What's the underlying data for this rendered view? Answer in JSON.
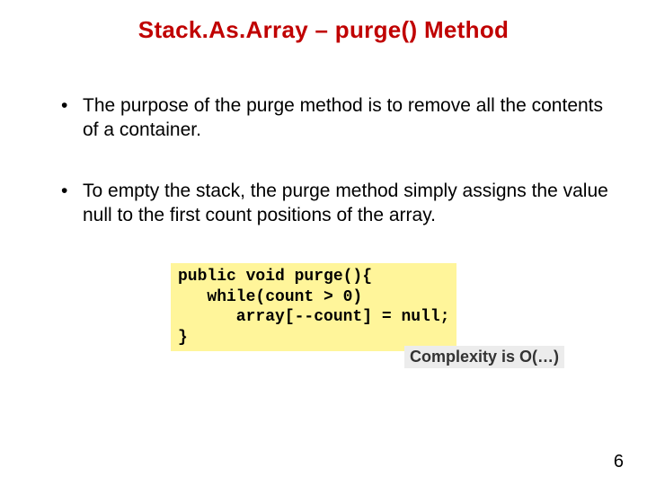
{
  "title": "Stack.As.Array – purge() Method",
  "bullets": [
    "The purpose of the purge method is to remove all the contents of a container.",
    "To empty the stack, the purge method simply assigns the value null to the first count positions of the array."
  ],
  "code": "public void purge(){\n   while(count > 0)\n      array[--count] = null;\n}",
  "complexity_label": "Complexity is O(…)",
  "page_number": "6"
}
